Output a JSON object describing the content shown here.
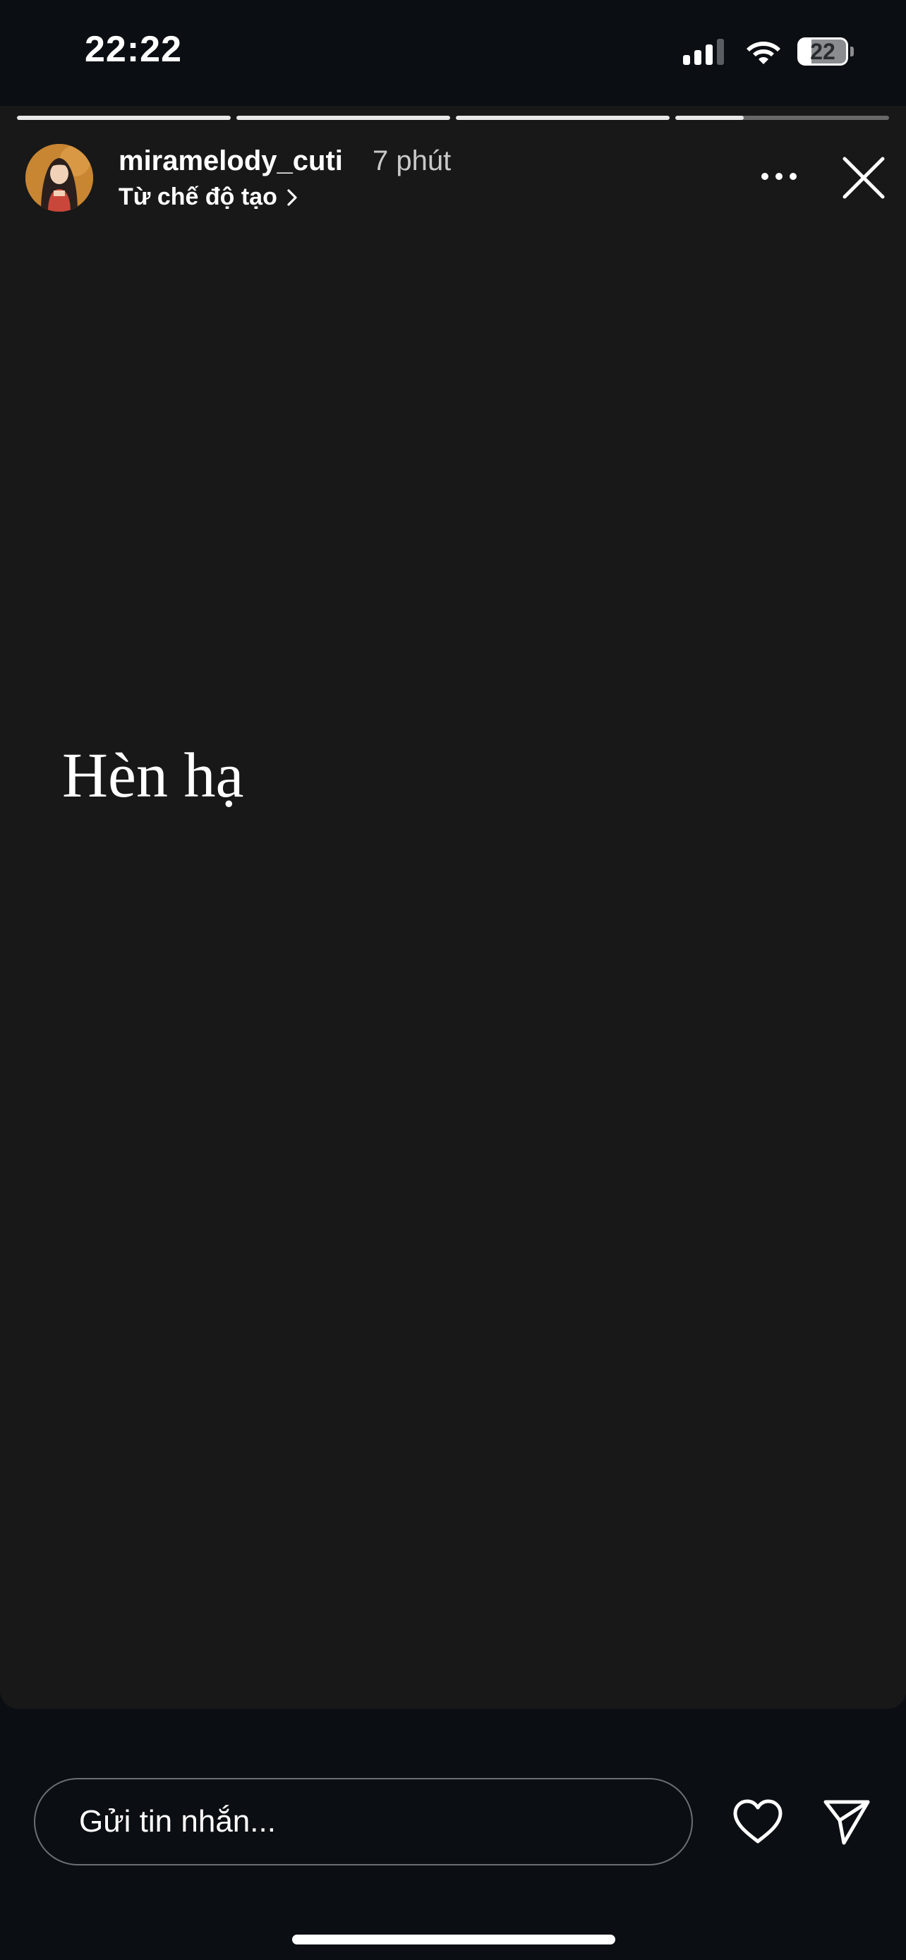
{
  "status_bar": {
    "time": "22:22",
    "battery_level": "22",
    "signal_icon": "cellular-signal-icon",
    "wifi_icon": "wifi-icon",
    "battery_icon": "battery-icon"
  },
  "story": {
    "progress": [
      1,
      1,
      1,
      0.32
    ],
    "username": "miramelody_cuti",
    "time_ago": "7 phút",
    "source_label": "Từ chế độ tạo",
    "text": "Hèn hạ",
    "background_color": "#181818",
    "icons": {
      "more": "more-horizontal-icon",
      "close": "close-icon",
      "source": "chevron-right-icon"
    }
  },
  "reply": {
    "placeholder": "Gửi tin nhắn...",
    "like_icon": "heart-icon",
    "share_icon": "send-icon"
  }
}
